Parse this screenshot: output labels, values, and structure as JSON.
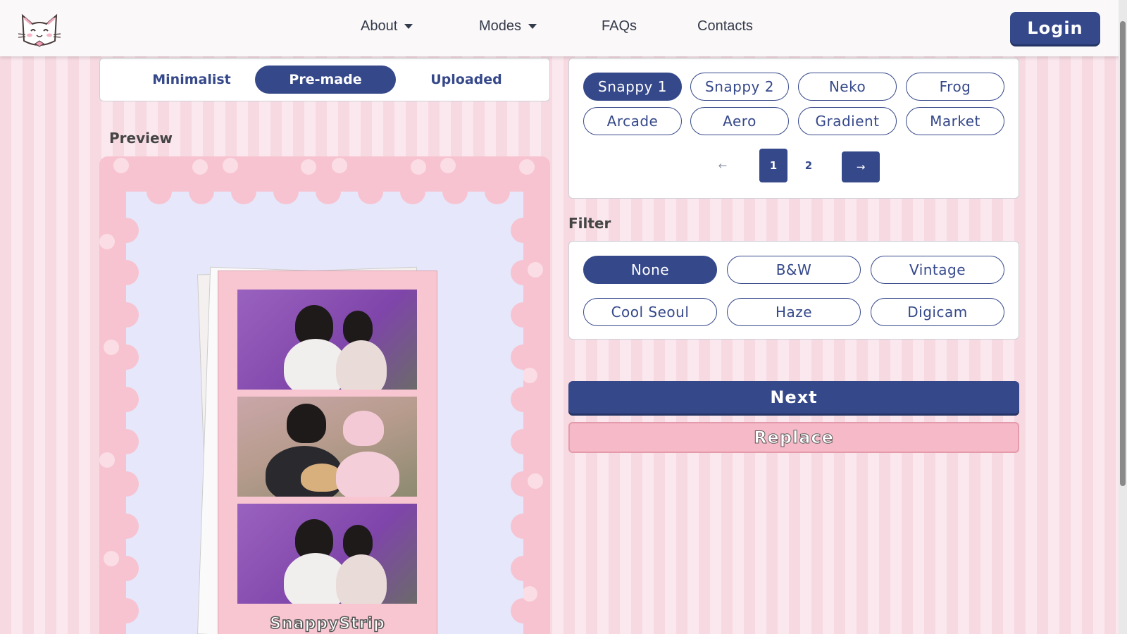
{
  "nav": {
    "items": [
      {
        "label": "About",
        "has_dropdown": true
      },
      {
        "label": "Modes",
        "has_dropdown": true
      },
      {
        "label": "FAQs",
        "has_dropdown": false
      },
      {
        "label": "Contacts",
        "has_dropdown": false
      }
    ],
    "login_label": "Login",
    "logo_icon": "cat-face-icon"
  },
  "mode_tabs": [
    {
      "label": "Minimalist",
      "active": false
    },
    {
      "label": "Pre-made",
      "active": true
    },
    {
      "label": "Uploaded",
      "active": false
    }
  ],
  "preview": {
    "label": "Preview",
    "strip_brand": "SnappyStrip"
  },
  "templates": {
    "items": [
      {
        "label": "Snappy 1",
        "active": true
      },
      {
        "label": "Snappy 2",
        "active": false
      },
      {
        "label": "Neko",
        "active": false
      },
      {
        "label": "Frog",
        "active": false
      },
      {
        "label": "Arcade",
        "active": false
      },
      {
        "label": "Aero",
        "active": false
      },
      {
        "label": "Gradient",
        "active": false
      },
      {
        "label": "Market",
        "active": false
      }
    ],
    "pagination": {
      "prev_icon": "arrow-left-icon",
      "pages": [
        "1",
        "2"
      ],
      "current_page": "1",
      "next_icon": "arrow-right-icon"
    }
  },
  "filter": {
    "label": "Filter",
    "options": [
      {
        "label": "None",
        "active": true
      },
      {
        "label": "B&W",
        "active": false
      },
      {
        "label": "Vintage",
        "active": false
      },
      {
        "label": "Cool Seoul",
        "active": false
      },
      {
        "label": "Haze",
        "active": false
      },
      {
        "label": "Digicam",
        "active": false
      }
    ]
  },
  "actions": {
    "next_label": "Next",
    "replace_label": "Replace"
  },
  "colors": {
    "primary": "#35488a",
    "pink": "#f7c3d0",
    "background_stripe": "#f7d9e2"
  }
}
